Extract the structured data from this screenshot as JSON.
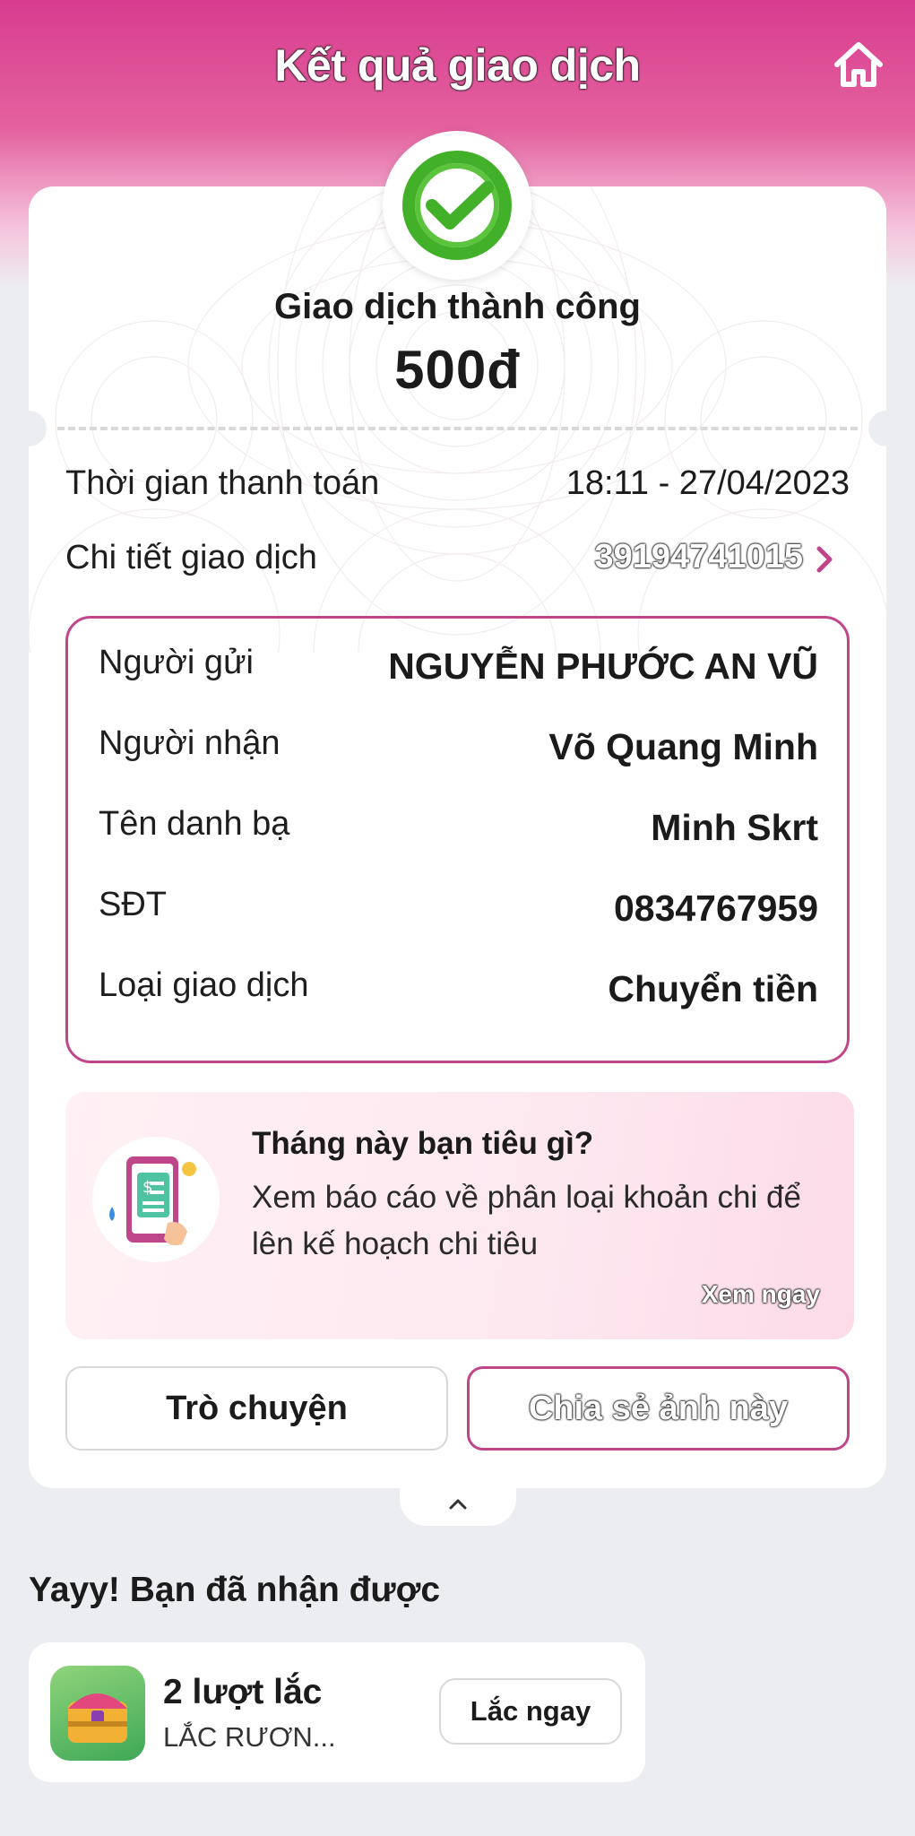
{
  "header": {
    "title": "Kết quả giao dịch",
    "home_icon": "home-icon"
  },
  "status": {
    "title": "Giao dịch thành công",
    "amount": "500đ",
    "icon": "check-circle-icon",
    "color": "#43b02a"
  },
  "summary": {
    "payment_time_label": "Thời gian thanh toán",
    "payment_time_value": "18:11 - 27/04/2023",
    "detail_label": "Chi tiết giao dịch",
    "detail_value": "39194741015"
  },
  "details": [
    {
      "label": "Người gửi",
      "value": "NGUYỄN PHƯỚC AN VŨ"
    },
    {
      "label": "Người nhận",
      "value": "Võ Quang Minh"
    },
    {
      "label": "Tên danh bạ",
      "value": "Minh Skrt"
    },
    {
      "label": "SĐT",
      "value": "0834767959"
    },
    {
      "label": "Loại giao dịch",
      "value": "Chuyển tiền"
    }
  ],
  "promo": {
    "title": "Tháng này bạn tiêu gì?",
    "description": "Xem báo cáo về phân loại khoản chi để lên kế hoạch chi tiêu",
    "link": "Xem ngay"
  },
  "actions": {
    "chat": "Trò chuyện",
    "share": "Chia sẻ ảnh này"
  },
  "rewards": {
    "title": "Yayy! Bạn đã nhận được",
    "count": "2 lượt lắc",
    "game": "LẮC RƯƠN...",
    "button": "Lắc ngay"
  },
  "colors": {
    "brand": "#d83c8e",
    "accent_border": "#c0468a",
    "success": "#43b02a"
  }
}
